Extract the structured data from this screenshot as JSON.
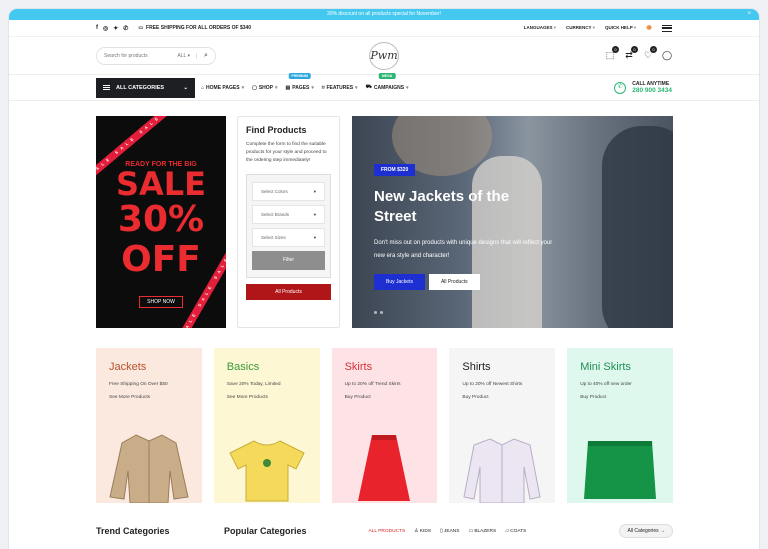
{
  "promo": {
    "text": "30% discount on all products special for November!",
    "close": "×"
  },
  "topbar": {
    "shipping": "FREE SHIPPING FOR ALL ORDERS OF $340",
    "languages": "LANGUAGES",
    "currency": "CURRENCY",
    "quick_help": "QUICK HELP"
  },
  "header": {
    "search_placeholder": "Search for products",
    "search_scope": "ALL",
    "logo_text": "Pwm",
    "badges": [
      "0",
      "0",
      "0"
    ]
  },
  "nav": {
    "all_categories": "ALL CATEGORIES",
    "items": [
      {
        "label": "HOME PAGES",
        "icon": "home-icon",
        "tag": ""
      },
      {
        "label": "SHOP",
        "icon": "bag-icon",
        "tag": ""
      },
      {
        "label": "PAGES",
        "icon": "page-icon",
        "tag": "PREMIUM"
      },
      {
        "label": "FEATURES",
        "icon": "tag-icon",
        "tag": ""
      },
      {
        "label": "CAMPAIGNS",
        "icon": "cart-icon",
        "tag": "MEGA"
      }
    ],
    "call_label": "CALL ANYTIME",
    "call_number": "280 900 3434",
    "colors": {
      "premium": "#2ba6de",
      "mega": "#2bb673",
      "green": "#2bb673"
    }
  },
  "sale_card": {
    "line1": "READY FOR THE BIG",
    "line2": "SALE",
    "line3": "30%",
    "line4": "OFF",
    "button": "SHOP NOW",
    "ribbon_text": "SALE SALE SALE"
  },
  "finder": {
    "title": "Find Products",
    "description": "Complete the form to find the suitable products for your style and proceed to the ordering step immediately!",
    "selects": [
      "Select Colors",
      "Select Brands",
      "Select Sizes"
    ],
    "filter": "Filter",
    "all_products": "All Products"
  },
  "banner": {
    "tag": "FROM $320",
    "title": "New Jackets of the Street",
    "description": "Don't miss out on products with unique designs that will reflect your new era style and character!",
    "primary": "Buy Jackets",
    "secondary": "All Products"
  },
  "categories": [
    {
      "title": "Jackets",
      "subtitle": "Free Shipping On Over $50",
      "link": "See More Products",
      "bg": "#fbe9e0",
      "title_color": "#b4532a",
      "item": "jacket-icon"
    },
    {
      "title": "Basics",
      "subtitle": "Save 20% Today, Limited",
      "link": "See More Products",
      "bg": "#fdf8d3",
      "title_color": "#3a9a38",
      "item": "tshirt-icon"
    },
    {
      "title": "Skirts",
      "subtitle": "Up to 20% off Trend Skirts",
      "link": "Buy Product",
      "bg": "#fde3e5",
      "title_color": "#d92f3a",
      "item": "skirt-icon"
    },
    {
      "title": "Shirts",
      "subtitle": "Up to 20% off Newest Shirts",
      "link": "Buy Product",
      "bg": "#f5f5f5",
      "title_color": "#222222",
      "item": "shirt-icon"
    },
    {
      "title": "Mini Skirts",
      "subtitle": "Up to 40% off new order",
      "link": "Buy Product",
      "bg": "#dff8ee",
      "title_color": "#1f8f54",
      "item": "mini-skirt-icon"
    }
  ],
  "bottom": {
    "trend": "Trend Categories",
    "popular": "Popular Categories",
    "tabs": [
      "ALL PRODUCTS",
      "KIDS",
      "JEANS",
      "BLAZERS",
      "COATS"
    ],
    "all_categories": "All Categories"
  }
}
